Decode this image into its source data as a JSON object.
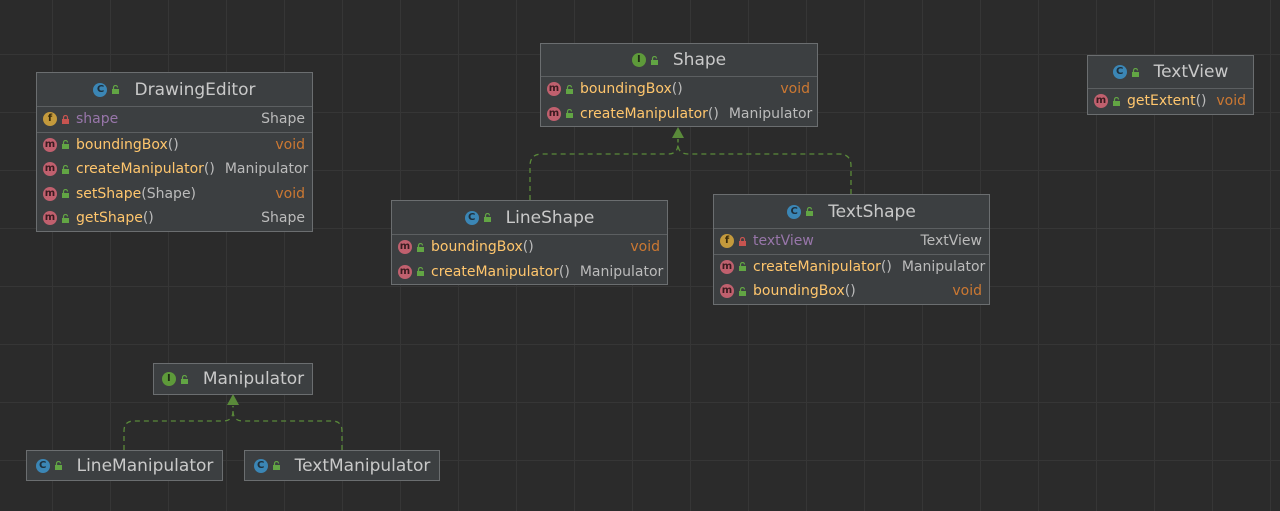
{
  "colors": {
    "background": "#2b2b2b",
    "node_fill": "#3c3f41",
    "method_name": "#ffc66d",
    "field_name": "#9876aa",
    "void_type": "#cc7832",
    "edge": "#5a8a3a"
  },
  "nodes": {
    "drawing_editor": {
      "kind": "C",
      "title": "DrawingEditor",
      "fields": [
        {
          "kind": "f",
          "name": "shape",
          "type": "Shape"
        }
      ],
      "methods": [
        {
          "kind": "m",
          "name": "boundingBox",
          "params": "()",
          "type": "void"
        },
        {
          "kind": "m",
          "name": "createManipulator",
          "params": "()",
          "type": "Manipulator"
        },
        {
          "kind": "m",
          "name": "setShape",
          "params": "(Shape)",
          "type": "void"
        },
        {
          "kind": "m",
          "name": "getShape",
          "params": "()",
          "type": "Shape"
        }
      ]
    },
    "shape": {
      "kind": "I",
      "title": "Shape",
      "methods": [
        {
          "kind": "m",
          "name": "boundingBox",
          "params": "()",
          "type": "void"
        },
        {
          "kind": "m",
          "name": "createManipulator",
          "params": "()",
          "type": "Manipulator"
        }
      ]
    },
    "text_view": {
      "kind": "C",
      "title": "TextView",
      "methods": [
        {
          "kind": "m",
          "name": "getExtent",
          "params": "()",
          "type": "void"
        }
      ]
    },
    "line_shape": {
      "kind": "C",
      "title": "LineShape",
      "methods": [
        {
          "kind": "m",
          "name": "boundingBox",
          "params": "()",
          "type": "void"
        },
        {
          "kind": "m",
          "name": "createManipulator",
          "params": "()",
          "type": "Manipulator"
        }
      ]
    },
    "text_shape": {
      "kind": "C",
      "title": "TextShape",
      "fields": [
        {
          "kind": "f",
          "name": "textView",
          "type": "TextView"
        }
      ],
      "methods": [
        {
          "kind": "m",
          "name": "createManipulator",
          "params": "()",
          "type": "Manipulator"
        },
        {
          "kind": "m",
          "name": "boundingBox",
          "params": "()",
          "type": "void"
        }
      ]
    },
    "manipulator": {
      "kind": "I",
      "title": "Manipulator"
    },
    "line_manipulator": {
      "kind": "C",
      "title": "LineManipulator"
    },
    "text_manipulator": {
      "kind": "C",
      "title": "TextManipulator"
    }
  },
  "edges": [
    {
      "from": "LineShape",
      "to": "Shape",
      "relation": "implements"
    },
    {
      "from": "TextShape",
      "to": "Shape",
      "relation": "implements"
    },
    {
      "from": "LineManipulator",
      "to": "Manipulator",
      "relation": "implements"
    },
    {
      "from": "TextManipulator",
      "to": "Manipulator",
      "relation": "implements"
    }
  ]
}
